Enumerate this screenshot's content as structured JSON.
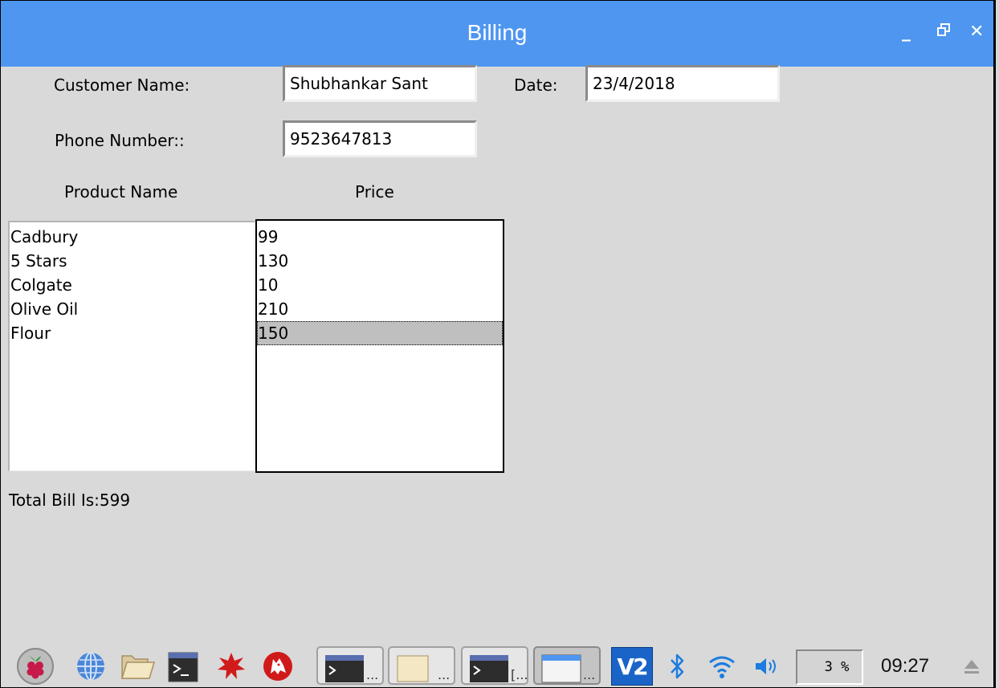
{
  "window": {
    "title": "Billing",
    "controls": {
      "minimize": "_",
      "restore": "□",
      "close": "✕"
    }
  },
  "form": {
    "customer_label": "Customer Name:",
    "customer_value": "Shubhankar Sant",
    "date_label": "Date:",
    "date_value": "23/4/2018",
    "phone_label": "Phone Number::",
    "phone_value": "9523647813"
  },
  "columns": {
    "product": "Product Name",
    "price": "Price"
  },
  "products": [
    "Cadbury",
    "5 Stars",
    "Colgate",
    "Olive Oil",
    "Flour"
  ],
  "prices": [
    "99",
    "130",
    "10",
    "210",
    "150"
  ],
  "selected_price_index": 4,
  "total_text": "Total Bill Is:599",
  "taskbar": {
    "cpu": "3 %",
    "time": "09:27",
    "task_dots": [
      "...",
      "...",
      "[...",
      "..."
    ],
    "vnc": "V2"
  },
  "colors": {
    "titlebar": "#4e96f0",
    "background": "#d9d9d9",
    "accent_blue": "#1c7ce0"
  }
}
